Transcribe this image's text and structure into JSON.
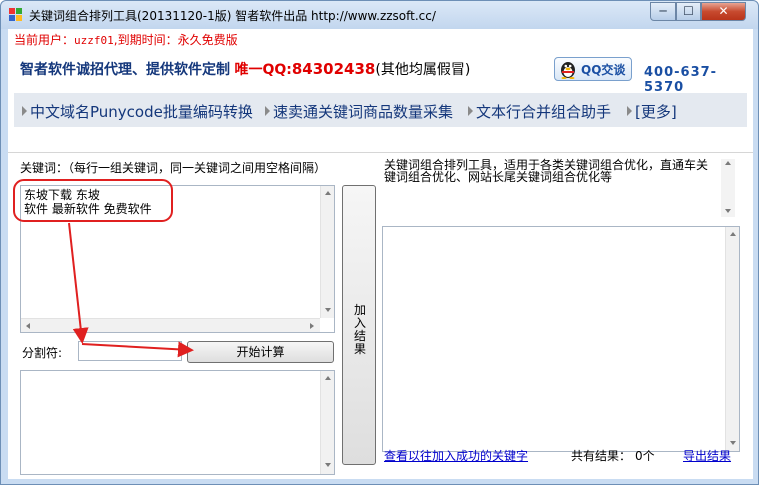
{
  "window": {
    "title": "关键词组合排列工具(20131120-1版) 智者软件出品 http://www.zzsoft.cc/",
    "min_symbol": "─",
    "max_symbol": "☐",
    "close_symbol": "✕"
  },
  "user": {
    "label": "当前用户：",
    "name": "uzzf01",
    "expire_label": ",到期时间：",
    "expire_value": "永久免费版"
  },
  "promo": {
    "slogan": "智者软件诚招代理、提供软件定制",
    "qq_prefix": "唯一QQ:",
    "qq_number": "84302438",
    "suffix": "(其他均属假冒)",
    "qq_button_label": "QQ交谈",
    "phone": "400-637-5370"
  },
  "nav": {
    "items": [
      "中文域名Punycode批量编码转换",
      "速卖通关键词商品数量采集",
      "文本行合并组合助手",
      "[更多]"
    ]
  },
  "keywords": {
    "label": "关键词：（每行一组关键词，同一关键词之间用空格间隔）",
    "line1": "东坡下载 东坡",
    "line2": "软件 最新软件 免费软件"
  },
  "separator": {
    "label": "分割符:",
    "value": ""
  },
  "buttons": {
    "calculate": "开始计算",
    "add_result": "加入结果"
  },
  "description": "关键词组合排列工具，适用于各类关键词组合优化，直通车关键词组合优化、网站长尾关键词组合优化等",
  "footer": {
    "history_link": "查看以往加入成功的关键字",
    "total_label": "共有结果：",
    "total_value": "0个",
    "export_link": "导出结果"
  },
  "colors": {
    "accent_red": "#e00000",
    "brand_blue": "#14377b",
    "link_blue": "#0000cc",
    "annotation_red": "#e02020"
  },
  "icons": [
    "app-icon",
    "qq-penguin-icon",
    "chevron-right-icon",
    "scroll-arrow-icon"
  ]
}
